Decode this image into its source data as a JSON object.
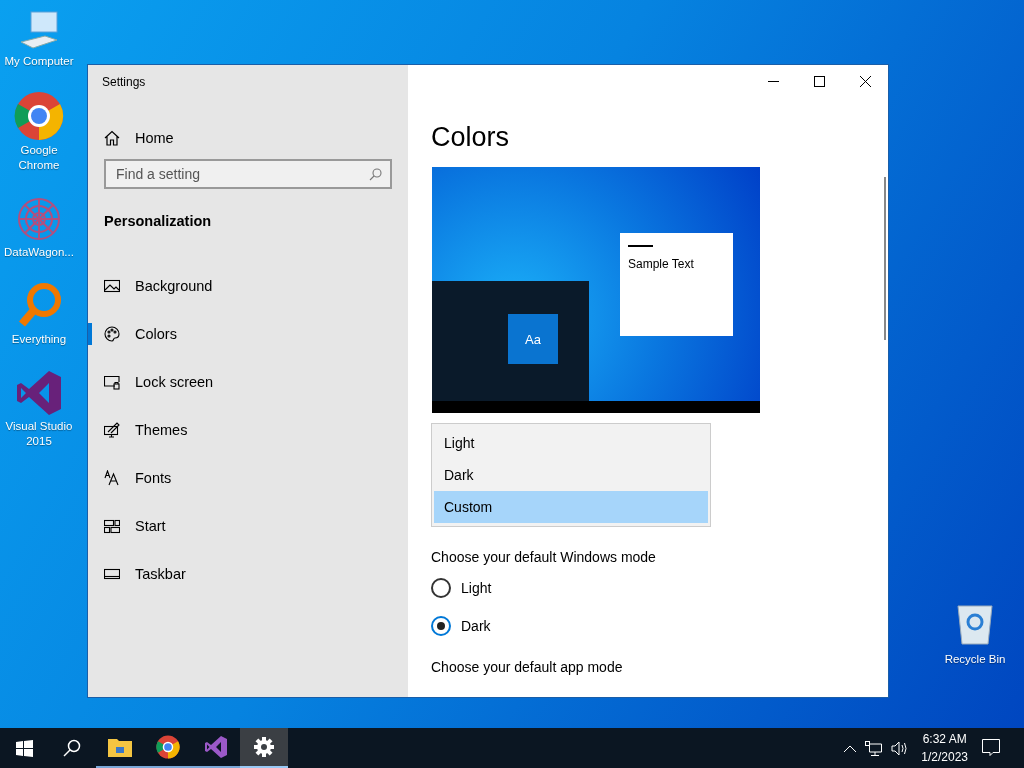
{
  "desktop_icons": [
    {
      "kind": "computer",
      "label": "My Computer"
    },
    {
      "kind": "chrome",
      "label": "Google Chrome"
    },
    {
      "kind": "datawagon",
      "label": "DataWagon..."
    },
    {
      "kind": "everything",
      "label": "Everything"
    },
    {
      "kind": "vs",
      "label": "Visual Studio 2015"
    }
  ],
  "recycle_bin": {
    "label": "Recycle Bin"
  },
  "window": {
    "title": "Settings",
    "controls": [
      {
        "kind": "minimize"
      },
      {
        "kind": "maximize"
      },
      {
        "kind": "close"
      }
    ]
  },
  "sidebar": {
    "home": "Home",
    "search": {
      "placeholder": "Find a setting"
    },
    "section": "Personalization",
    "items": [
      {
        "kind": "background",
        "label": "Background",
        "selected": false
      },
      {
        "kind": "colors",
        "label": "Colors",
        "selected": true
      },
      {
        "kind": "lock",
        "label": "Lock screen",
        "selected": false
      },
      {
        "kind": "themes",
        "label": "Themes",
        "selected": false
      },
      {
        "kind": "fonts",
        "label": "Fonts",
        "selected": false
      },
      {
        "kind": "start",
        "label": "Start",
        "selected": false
      },
      {
        "kind": "taskbar",
        "label": "Taskbar",
        "selected": false
      }
    ]
  },
  "content": {
    "heading": "Colors",
    "preview": {
      "tile_label": "Aa",
      "sample_text": "Sample Text"
    },
    "dropdown_options": [
      {
        "label": "Light",
        "selected": false
      },
      {
        "label": "Dark",
        "selected": false
      },
      {
        "label": "Custom",
        "selected": true
      }
    ],
    "windows_mode": {
      "label": "Choose your default Windows mode",
      "options": [
        {
          "label": "Light",
          "selected": false
        },
        {
          "label": "Dark",
          "selected": true
        }
      ]
    },
    "app_mode_label": "Choose your default app mode"
  },
  "taskbar": {
    "apps": [
      {
        "kind": "explorer",
        "active": false
      },
      {
        "kind": "chrome",
        "active": false
      },
      {
        "kind": "vs",
        "active": false
      },
      {
        "kind": "settings",
        "active": true
      }
    ],
    "time": "6:32 AM",
    "date": "1/2/2023"
  }
}
